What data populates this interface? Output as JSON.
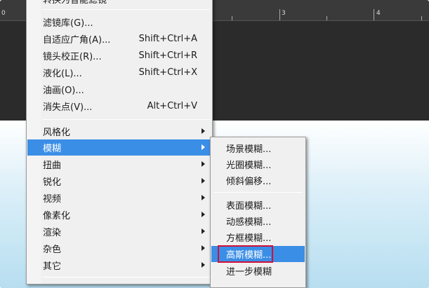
{
  "ruler": {
    "labels": [
      "0",
      "3",
      "4"
    ]
  },
  "menu": {
    "top_item": "转换为智能滤镜",
    "items": [
      {
        "label": "滤镜库(G)...",
        "shortcut": ""
      },
      {
        "label": "自适应广角(A)...",
        "shortcut": "Shift+Ctrl+A"
      },
      {
        "label": "镜头校正(R)...",
        "shortcut": "Shift+Ctrl+R"
      },
      {
        "label": "液化(L)...",
        "shortcut": "Shift+Ctrl+X"
      },
      {
        "label": "油画(O)...",
        "shortcut": ""
      },
      {
        "label": "消失点(V)...",
        "shortcut": "Alt+Ctrl+V"
      }
    ],
    "filters": [
      {
        "label": "风格化"
      },
      {
        "label": "模糊"
      },
      {
        "label": "扭曲"
      },
      {
        "label": "锐化"
      },
      {
        "label": "视频"
      },
      {
        "label": "像素化"
      },
      {
        "label": "渲染"
      },
      {
        "label": "杂色"
      },
      {
        "label": "其它"
      }
    ]
  },
  "submenu": {
    "group1": [
      "场景模糊...",
      "光圈模糊...",
      "倾斜偏移..."
    ],
    "group2": [
      "表面模糊...",
      "动感模糊...",
      "方框模糊...",
      "高斯模糊...",
      "进一步模糊"
    ]
  },
  "colors": {
    "highlight": "#3b8ee6",
    "mark": "#d0103a"
  }
}
